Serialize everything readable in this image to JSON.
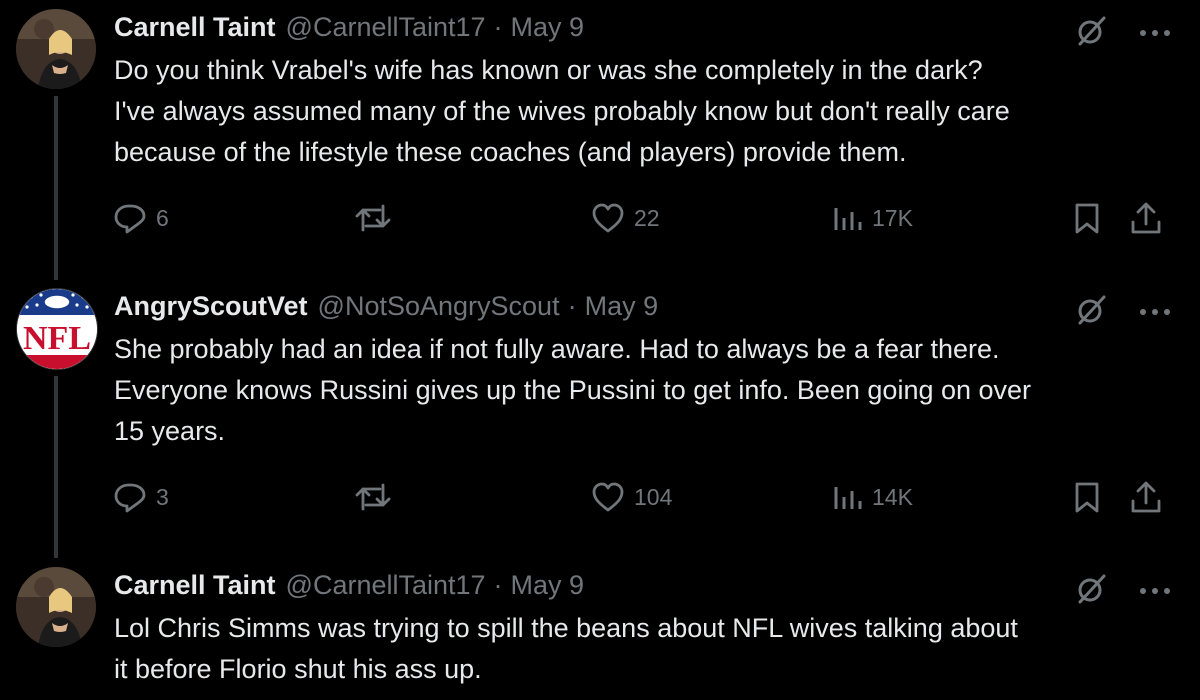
{
  "tweets": [
    {
      "name": "Carnell Taint",
      "handle": "@CarnellTaint17",
      "separator": "·",
      "date": "May 9",
      "text_lines": [
        "Do you think Vrabel's wife has known or was she completely in the dark?",
        "I've always assumed many of the wives probably know but don't really care",
        "because of the lifestyle these coaches (and players) provide them."
      ],
      "replies": "6",
      "retweets": "",
      "likes": "22",
      "views": "17K"
    },
    {
      "name": "AngryScoutVet",
      "handle": "@NotSoAngryScout",
      "separator": "·",
      "date": "May 9",
      "text_lines": [
        "She probably had an idea if not fully aware. Had to always be a fear there.",
        "Everyone knows Russini gives up the Pussini to get info. Been going on over",
        "15 years."
      ],
      "replies": "3",
      "retweets": "",
      "likes": "104",
      "views": "14K"
    },
    {
      "name": "Carnell Taint",
      "handle": "@CarnellTaint17",
      "separator": "·",
      "date": "May 9",
      "text_lines": [
        "Lol Chris Simms was trying to spill the beans about NFL wives talking about",
        "it before Florio shut his ass up."
      ]
    }
  ],
  "nfl_logo_text": "NFL",
  "colors": {
    "background": "#000000",
    "text": "#e7e9ea",
    "muted": "#71767b",
    "thread_line": "#333639"
  },
  "icons": [
    "grok-icon",
    "more-icon",
    "reply-icon",
    "retweet-icon",
    "like-icon",
    "views-icon",
    "bookmark-icon",
    "share-icon"
  ]
}
